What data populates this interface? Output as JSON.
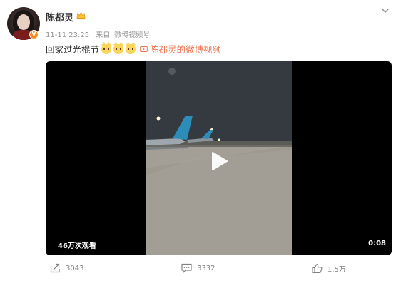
{
  "post": {
    "username": "陈都灵",
    "verified_badge": "V",
    "timestamp": "11-11 23:25",
    "source_prefix": "来自",
    "source": "微博视频号",
    "text": "回家过光棍节",
    "video_link_label": "陈都灵的微博视频"
  },
  "video": {
    "view_count": "46万次观看",
    "duration": "0:08"
  },
  "actions": {
    "share_count": "3043",
    "comment_count": "3332",
    "like_count": "1.5万"
  },
  "colors": {
    "accent": "#eb7350",
    "badge": "#f78b22",
    "meta_text": "#939393"
  },
  "icons": [
    "avatar",
    "crown-icon",
    "chevron-down-icon",
    "emoji-icon",
    "video-link-icon",
    "play-icon",
    "share-icon",
    "comment-icon",
    "like-icon"
  ]
}
